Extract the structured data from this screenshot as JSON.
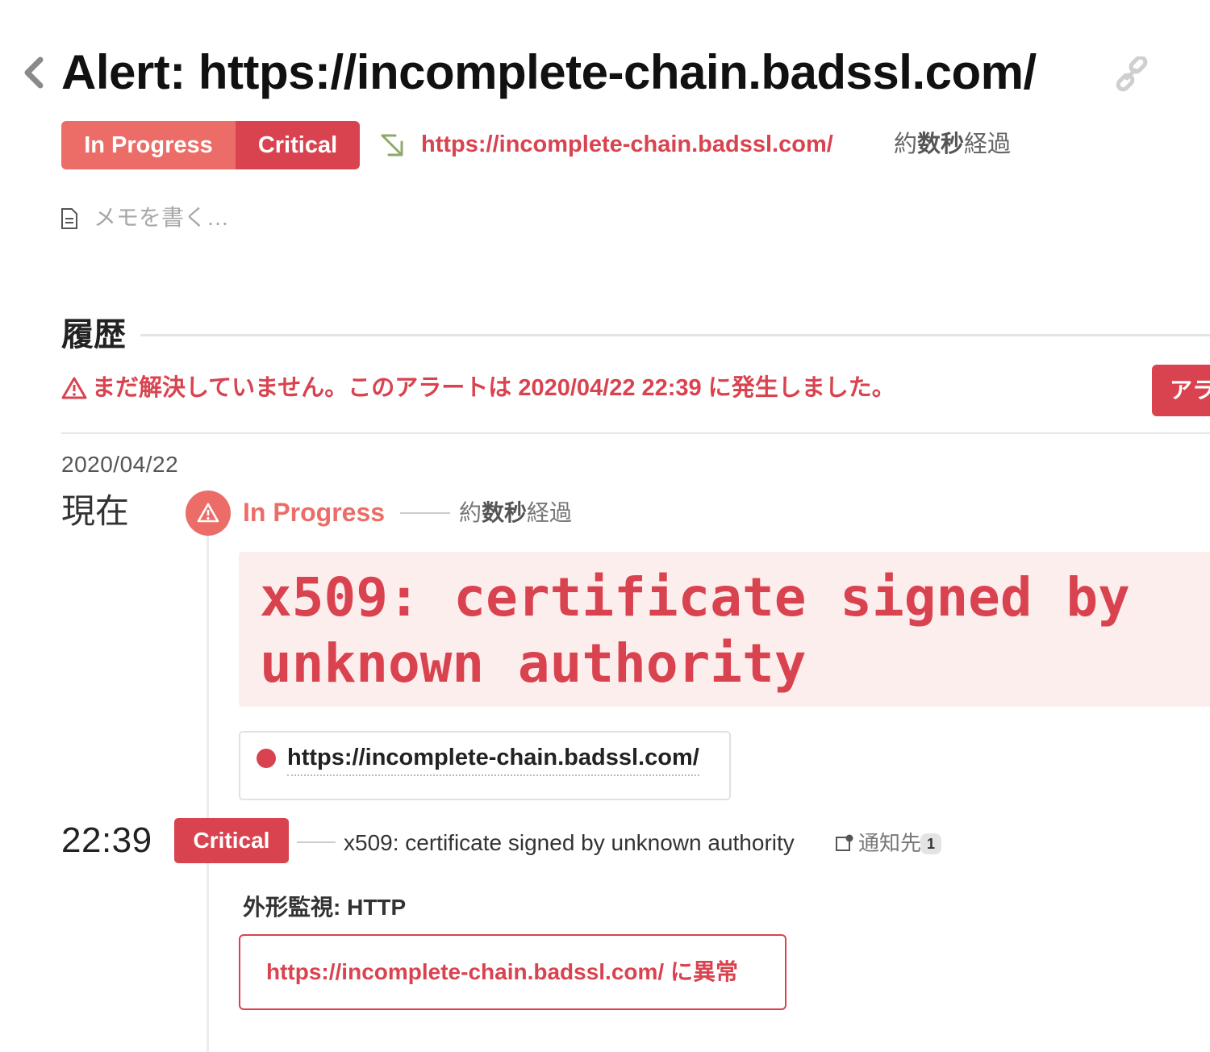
{
  "header": {
    "title": "Alert: https://incomplete-chain.badssl.com/",
    "status_label": "In Progress",
    "severity_label": "Critical",
    "monitor_url": "https://incomplete-chain.badssl.com/",
    "elapsed_prefix": "約",
    "elapsed_bold": "数秒",
    "elapsed_suffix": "経過"
  },
  "memo": {
    "placeholder": "メモを書く…"
  },
  "history": {
    "title": "履歴",
    "unresolved_notice": "まだ解決していません。このアラートは 2020/04/22 22:39 に発生しました。",
    "action_button_label": "アラ",
    "date": "2020/04/22",
    "current_label": "現在",
    "current_state": {
      "label": "In Progress",
      "elapsed_prefix": "約",
      "elapsed_bold": "数秒",
      "elapsed_suffix": "経過",
      "message": "x509: certificate signed by unknown authority",
      "host": "https://incomplete-chain.badssl.com/"
    },
    "event": {
      "time": "22:39",
      "severity_label": "Critical",
      "message": "x509: certificate signed by unknown authority",
      "notify_label": "通知先",
      "notify_count": "1",
      "monitor_type": "外形監視: HTTP",
      "monitor_link": "https://incomplete-chain.badssl.com/ に異常"
    }
  },
  "colors": {
    "critical": "#d9434f",
    "in_progress": "#ec6d68",
    "message_bg": "#fdeeee"
  },
  "icons": [
    "chevron-left-icon",
    "link-icon",
    "monitor-arrow-icon",
    "memo-icon",
    "warning-icon",
    "notify-icon"
  ]
}
